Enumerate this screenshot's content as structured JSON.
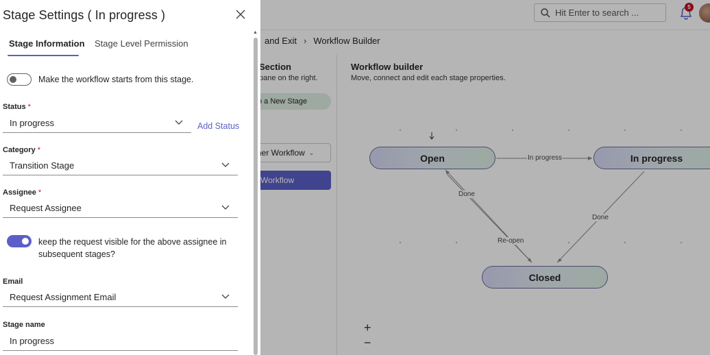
{
  "app": {
    "search_placeholder": "Hit Enter to search ...",
    "notification_count": "5",
    "breadcrumb": [
      "and Exit",
      "Workflow Builder"
    ],
    "left_pane": {
      "title": "Section",
      "subtitle": "pane on the right.",
      "add_stage": "o a New Stage",
      "other_workflow": "her Workflow",
      "workflow_button": "Workflow"
    },
    "workflow": {
      "title": "Workflow builder",
      "subtitle": "Move, connect and edit each stage properties.",
      "nodes": {
        "open": "Open",
        "in_progress": "In progress",
        "closed": "Closed"
      },
      "edges": {
        "open_to_progress": "In progress",
        "closed_to_open": "Done",
        "progress_to_closed": "Done",
        "reopen": "Re-open"
      },
      "zoom_in": "+",
      "zoom_out": "−"
    }
  },
  "panel": {
    "title": "Stage Settings ( In progress )",
    "tabs": [
      "Stage Information",
      "Stage Level Permission"
    ],
    "start_toggle": {
      "label": "Make the workflow starts from this stage.",
      "on": false
    },
    "status": {
      "label": "Status",
      "required": "*",
      "value": "In progress",
      "add_link": "Add Status"
    },
    "category": {
      "label": "Category",
      "required": "*",
      "value": "Transition Stage"
    },
    "assignee": {
      "label": "Assignee",
      "required": "*",
      "value": "Request Assignee"
    },
    "visible_toggle": {
      "label_line1": "keep the request visible for the above assignee in",
      "label_line2": "subsequent stages?",
      "on": true
    },
    "email": {
      "label": "Email",
      "value": "Request Assignment Email"
    },
    "stage_name": {
      "label": "Stage name",
      "value": "In progress"
    }
  },
  "colors": {
    "accent": "#5b5fc7",
    "required": "#c50f1f",
    "overlay": "rgba(0,0,0,0.29)"
  }
}
